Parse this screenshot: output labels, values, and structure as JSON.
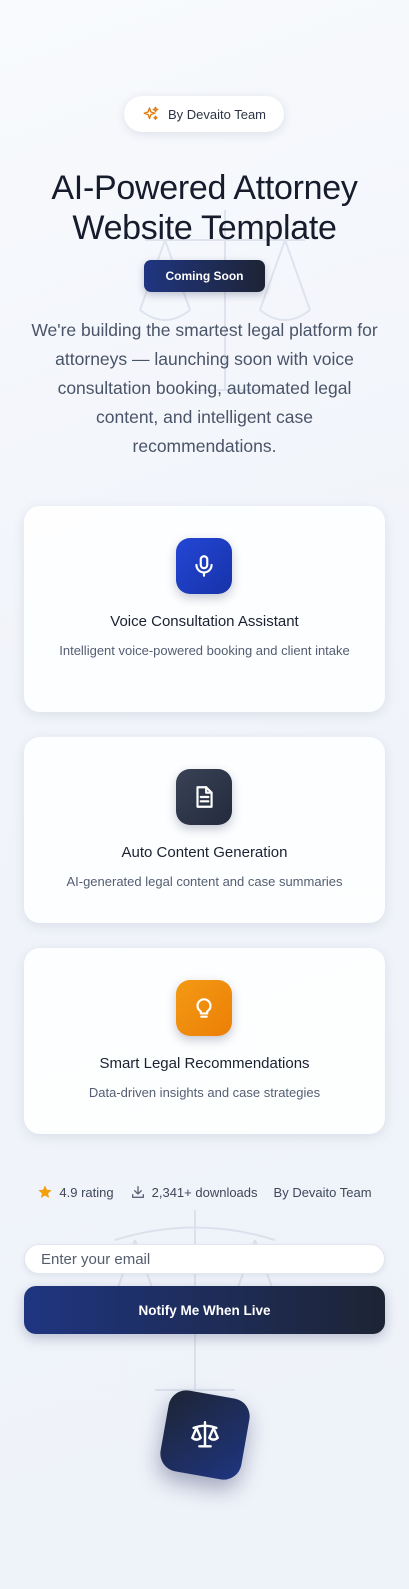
{
  "badge": {
    "icon": "sparkles-icon",
    "text": "By Devaito Team"
  },
  "hero": {
    "title_line1": "AI-Powered Attorney",
    "title_line2": "Website Template",
    "tag": "Coming Soon",
    "description": "We're building the smartest legal platform for attorneys — launching soon with voice consultation booking, automated legal content, and intelligent case recommendations."
  },
  "features": [
    {
      "icon": "microphone-icon",
      "title": "Voice Consultation Assistant",
      "description": "Intelligent voice-powered booking and client intake",
      "color": "#1d3fc4"
    },
    {
      "icon": "document-icon",
      "title": "Auto Content Generation",
      "description": "AI-generated legal content and case summaries",
      "color": "#2b3246"
    },
    {
      "icon": "lightbulb-icon",
      "title": "Smart Legal Recommendations",
      "description": "Data-driven insights and case strategies",
      "color": "#f08a0c"
    }
  ],
  "stats": {
    "rating": "4.9 rating",
    "downloads": "2,341+ downloads",
    "author": "By Devaito Team"
  },
  "signup": {
    "email_placeholder": "Enter your email",
    "email_value": "",
    "button_label": "Notify Me When Live"
  },
  "logo": {
    "icon": "scales-of-justice-icon"
  },
  "colors": {
    "accent_dark": "#1d2434",
    "accent_blue": "#1f3580",
    "star": "#f59e0b"
  }
}
